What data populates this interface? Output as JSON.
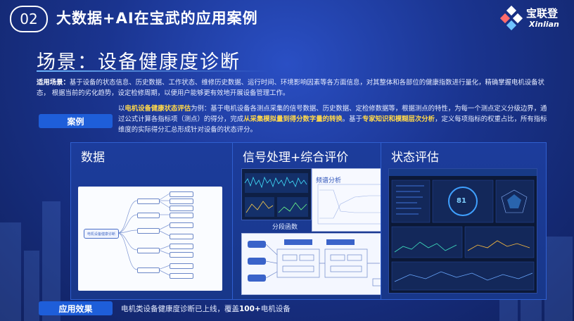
{
  "header": {
    "section_number": "02",
    "title": "大数据+AI在宝武的应用案例",
    "logo_cn": "宝联登",
    "logo_en": "Xinlian"
  },
  "scene": {
    "heading": "场景：设备健康度诊断",
    "applicable_label": "适用场景：",
    "applicable_text": "基于设备的状态信息、历史数据、工作状态、维修历史数据、运行时间、环境影响因素等各方面信息，对其整体和各部位的健康指数进行量化，精确掌握电机设备状态， 根据当前的劣化趋势，设定检修周期，以便用户能够更有效地开展设备管理工作。"
  },
  "case": {
    "tag": "案例",
    "prefix": "以",
    "highlight1": "电机设备健康状态评估",
    "part2": "为例：基于电机设备各测点采集的信号数据、历史数据、定检修数据等，根据测点的特性，为每一个测点定义分级边界，通过公式计算各指标项（测点）的得分，完成",
    "highlight2": "从采集模拟量到得分数字量的转换",
    "part3": "。基于",
    "highlight3": "专家知识和模糊层次分析",
    "part4": "，定义每项指标的权重占比，所有指标维度的实际得分汇总形成针对设备的状态评分。"
  },
  "panels": {
    "data_title": "数据",
    "signal_title": "信号处理+综合评价",
    "status_title": "状态评估",
    "spectrum_label": "频谱分析",
    "grading_label": "分段函数",
    "dashboard_score": "81"
  },
  "mindmap": {
    "root_label": "电机设备健康诊断"
  },
  "bottom": {
    "tag": "应用效果",
    "text_prefix": "电机类设备健康度诊断已上线，覆盖",
    "number": "100+",
    "text_suffix": "电机设备"
  },
  "colors": {
    "accent_blue": "#1e5ed9",
    "highlight_yellow": "#ffd84a",
    "bg_dark": "#10215f"
  }
}
